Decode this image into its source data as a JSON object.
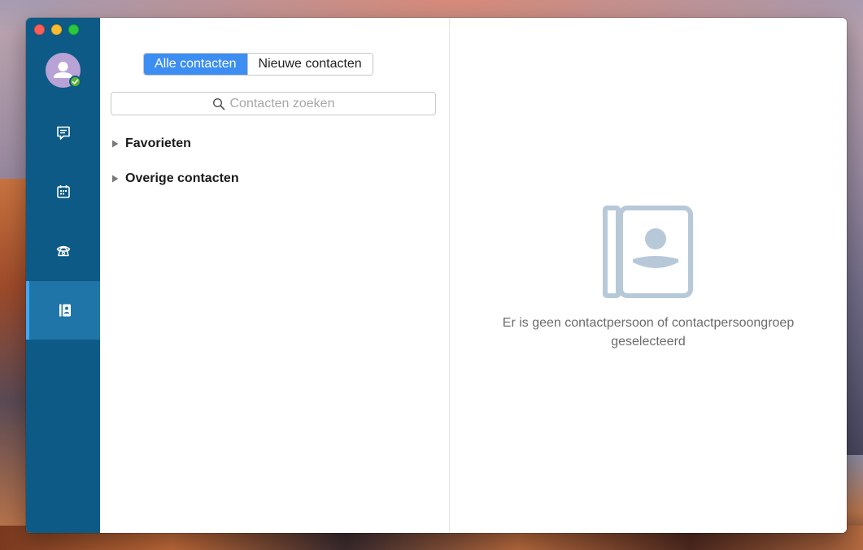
{
  "window": {
    "sidebar": {
      "nav": [
        {
          "id": "chat",
          "icon": "chat-icon"
        },
        {
          "id": "calendar",
          "icon": "calendar-icon"
        },
        {
          "id": "phone",
          "icon": "phone-icon"
        },
        {
          "id": "contacts",
          "icon": "contacts-icon",
          "active": true
        }
      ],
      "avatar_status": "online"
    },
    "tabs": {
      "all": "Alle contacten",
      "new": "Nieuwe contacten",
      "selected": "all"
    },
    "search": {
      "placeholder": "Contacten zoeken"
    },
    "groups": [
      {
        "label": "Favorieten",
        "expanded": false
      },
      {
        "label": "Overige contacten",
        "expanded": false
      }
    ],
    "detail": {
      "empty_message": "Er is geen contactpersoon of contactpersoongroep geselecteerd",
      "icon": "address-book-icon"
    }
  },
  "colors": {
    "sidebar": "#0d5a86",
    "sidebar_active": "#1f75a8",
    "accent": "#3d8ef3",
    "status_online": "#59b52f",
    "empty_icon": "#b7c9d9"
  }
}
